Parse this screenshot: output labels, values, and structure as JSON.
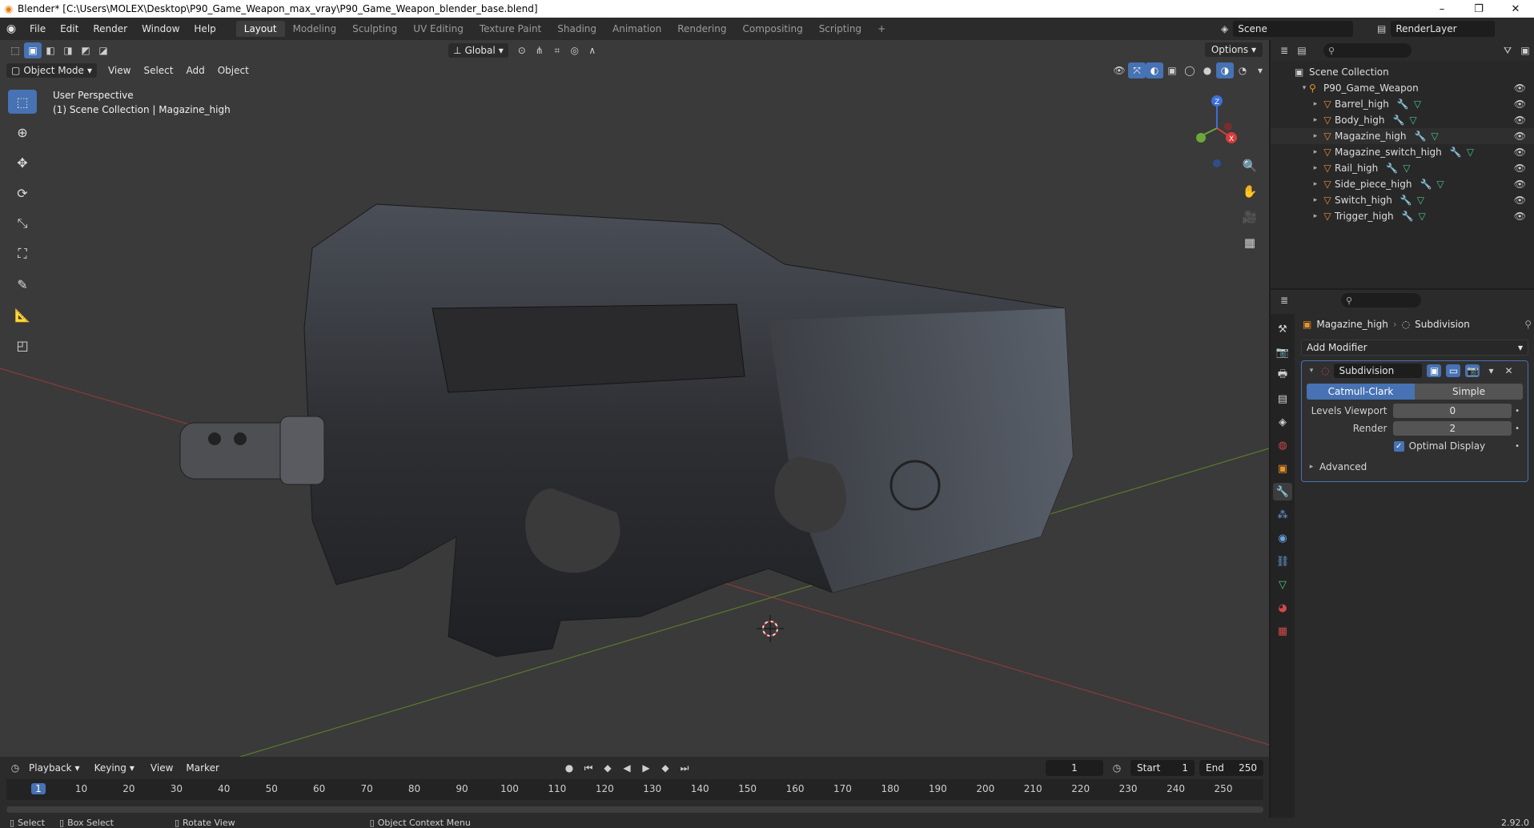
{
  "titlebar": {
    "title": "Blender* [C:\\Users\\MOLEX\\Desktop\\P90_Game_Weapon_max_vray\\P90_Game_Weapon_blender_base.blend]",
    "minimize": "–",
    "maximize": "❐",
    "close": "✕"
  },
  "menu": {
    "items": [
      "File",
      "Edit",
      "Render",
      "Window",
      "Help"
    ]
  },
  "workspaces": [
    "Layout",
    "Modeling",
    "Sculpting",
    "UV Editing",
    "Texture Paint",
    "Shading",
    "Animation",
    "Rendering",
    "Compositing",
    "Scripting"
  ],
  "scene": {
    "label": "Scene",
    "render_layer": "RenderLayer"
  },
  "viewport": {
    "transform_orientation": "Global",
    "options_label": "Options",
    "mode": "Object Mode",
    "menus": [
      "View",
      "Select",
      "Add",
      "Object"
    ],
    "info_line1": "User Perspective",
    "info_line2": "(1) Scene Collection | Magazine_high",
    "gizmo": {
      "z": "Z",
      "x": "X",
      "y": "Y"
    }
  },
  "timeline": {
    "menus": [
      "Playback",
      "Keying",
      "View",
      "Marker"
    ],
    "current_frame": "1",
    "start_label": "Start",
    "start_value": "1",
    "end_label": "End",
    "end_value": "250",
    "ruler": [
      "1",
      "10",
      "20",
      "30",
      "40",
      "50",
      "60",
      "70",
      "80",
      "90",
      "100",
      "110",
      "120",
      "130",
      "140",
      "150",
      "160",
      "170",
      "180",
      "190",
      "200",
      "210",
      "220",
      "230",
      "240",
      "250"
    ]
  },
  "statusbar": {
    "select": "Select",
    "box_select": "Box Select",
    "rotate_view": "Rotate View",
    "context_menu": "Object Context Menu",
    "version": "2.92.0"
  },
  "outliner": {
    "root": "Scene Collection",
    "collection": "P90_Game_Weapon",
    "objects": [
      "Barrel_high",
      "Body_high",
      "Magazine_high",
      "Magazine_switch_high",
      "Rail_high",
      "Side_piece_high",
      "Switch_high",
      "Trigger_high"
    ]
  },
  "properties": {
    "object_name": "Magazine_high",
    "modifier_crumb": "Subdivision",
    "add_modifier": "Add Modifier",
    "modifier_name": "Subdivision",
    "mode_catmull": "Catmull-Clark",
    "mode_simple": "Simple",
    "levels_viewport_label": "Levels Viewport",
    "levels_viewport_value": "0",
    "render_label": "Render",
    "render_value": "2",
    "optimal_display": "Optimal Display",
    "advanced": "Advanced"
  },
  "colors": {
    "accent": "#4772b3",
    "object_orange": "#e8932b",
    "modifier_blue": "#6aa4e0",
    "mesh_green": "#4fc38a",
    "viewport_bg": "#3a3a3a"
  }
}
